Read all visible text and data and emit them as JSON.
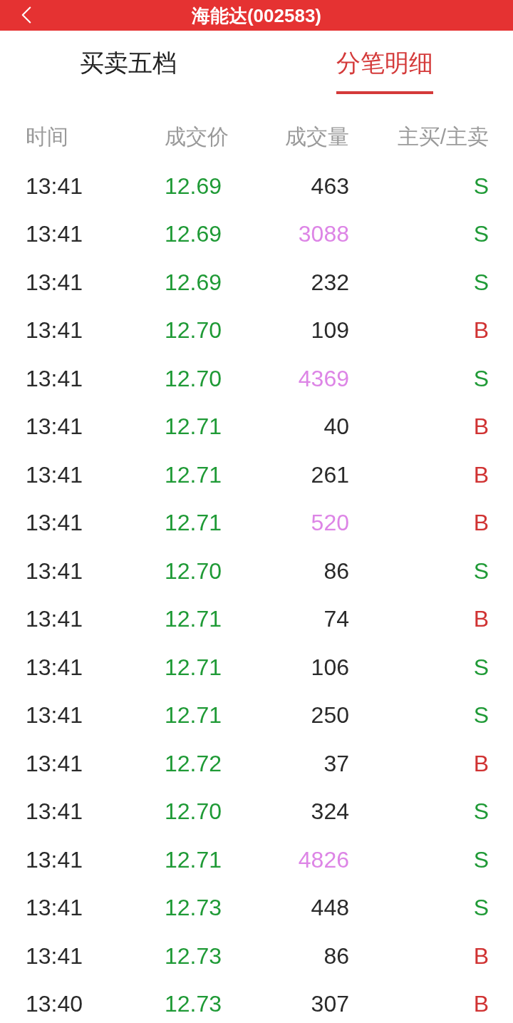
{
  "header": {
    "title": "海能达(002583)"
  },
  "tabs": [
    {
      "label": "买卖五档",
      "selected": false
    },
    {
      "label": "分笔明细",
      "selected": true
    }
  ],
  "table": {
    "columns": [
      "时间",
      "成交价",
      "成交量",
      "主买/主卖"
    ],
    "rows": [
      {
        "time": "13:41",
        "price": "12.69",
        "volume": "463",
        "large": false,
        "side": "S",
        "kind": "sell"
      },
      {
        "time": "13:41",
        "price": "12.69",
        "volume": "3088",
        "large": true,
        "side": "S",
        "kind": "sell"
      },
      {
        "time": "13:41",
        "price": "12.69",
        "volume": "232",
        "large": false,
        "side": "S",
        "kind": "sell"
      },
      {
        "time": "13:41",
        "price": "12.70",
        "volume": "109",
        "large": false,
        "side": "B",
        "kind": "buy"
      },
      {
        "time": "13:41",
        "price": "12.70",
        "volume": "4369",
        "large": true,
        "side": "S",
        "kind": "sell"
      },
      {
        "time": "13:41",
        "price": "12.71",
        "volume": "40",
        "large": false,
        "side": "B",
        "kind": "buy"
      },
      {
        "time": "13:41",
        "price": "12.71",
        "volume": "261",
        "large": false,
        "side": "B",
        "kind": "buy"
      },
      {
        "time": "13:41",
        "price": "12.71",
        "volume": "520",
        "large": true,
        "side": "B",
        "kind": "buy"
      },
      {
        "time": "13:41",
        "price": "12.70",
        "volume": "86",
        "large": false,
        "side": "S",
        "kind": "sell"
      },
      {
        "time": "13:41",
        "price": "12.71",
        "volume": "74",
        "large": false,
        "side": "B",
        "kind": "buy"
      },
      {
        "time": "13:41",
        "price": "12.71",
        "volume": "106",
        "large": false,
        "side": "S",
        "kind": "sell"
      },
      {
        "time": "13:41",
        "price": "12.71",
        "volume": "250",
        "large": false,
        "side": "S",
        "kind": "sell"
      },
      {
        "time": "13:41",
        "price": "12.72",
        "volume": "37",
        "large": false,
        "side": "B",
        "kind": "buy"
      },
      {
        "time": "13:41",
        "price": "12.70",
        "volume": "324",
        "large": false,
        "side": "S",
        "kind": "sell"
      },
      {
        "time": "13:41",
        "price": "12.71",
        "volume": "4826",
        "large": true,
        "side": "S",
        "kind": "sell"
      },
      {
        "time": "13:41",
        "price": "12.73",
        "volume": "448",
        "large": false,
        "side": "S",
        "kind": "sell"
      },
      {
        "time": "13:41",
        "price": "12.73",
        "volume": "86",
        "large": false,
        "side": "B",
        "kind": "buy"
      },
      {
        "time": "13:40",
        "price": "12.73",
        "volume": "307",
        "large": false,
        "side": "B",
        "kind": "buy"
      }
    ]
  }
}
